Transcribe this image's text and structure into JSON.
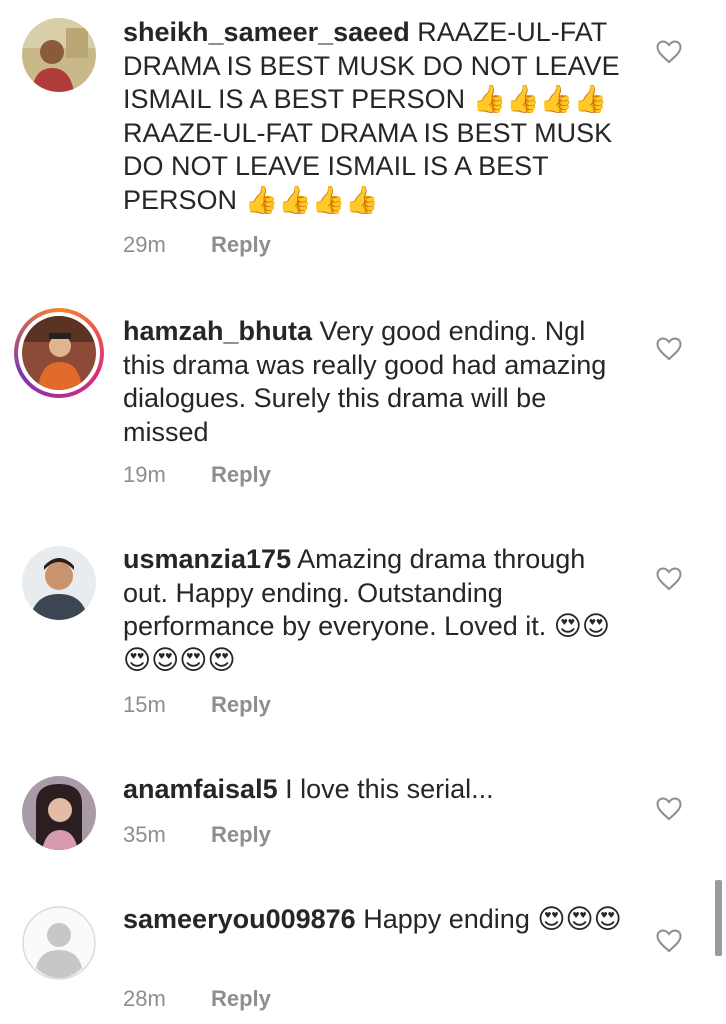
{
  "comments": [
    {
      "username": "sheikh_sameer_saeed",
      "text": "RAAZE-UL-FAT DRAMA IS BEST MUSK DO NOT LEAVE ISMAIL IS A BEST PERSON 👍👍👍👍 RAAZE-UL-FAT DRAMA IS BEST MUSK DO NOT LEAVE ISMAIL IS A BEST PERSON 👍👍👍👍",
      "time": "29m",
      "reply_label": "Reply"
    },
    {
      "username": "hamzah_bhuta",
      "text": "Very good ending. Ngl this drama was really good had amazing dialogues. Surely this drama will be missed",
      "time": "19m",
      "reply_label": "Reply"
    },
    {
      "username": "usmanzia175",
      "text": "Amazing drama through out. Happy ending. Outstanding performance by everyone. Loved it. 😍😍😍😍😍😍",
      "time": "15m",
      "reply_label": "Reply"
    },
    {
      "username": "anamfaisal5",
      "text": "I love this serial...",
      "time": "35m",
      "reply_label": "Reply"
    },
    {
      "username": "sameeryou009876",
      "text": "Happy ending 😍😍😍",
      "time": "28m",
      "reply_label": "Reply"
    }
  ],
  "icons": {
    "like": "heart-outline-icon",
    "default_avatar": "default-profile-icon"
  },
  "colors": {
    "text": "#262626",
    "secondary": "#8e8e8e",
    "story_ring": [
      "#f58529",
      "#dd2a7b",
      "#8134af"
    ]
  }
}
